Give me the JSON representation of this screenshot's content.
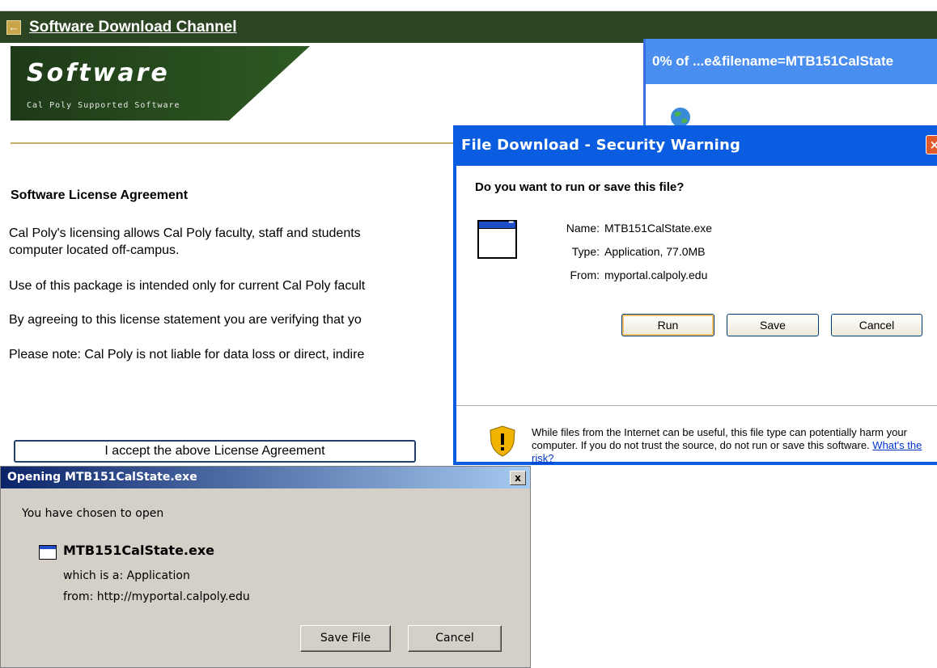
{
  "page": {
    "back_icon": "arrow-left-icon",
    "channel_title": "Software Download Channel",
    "banner": {
      "logo_word": "Software",
      "tagline": "Cal Poly Supported Software"
    },
    "heading": "Software License Agreement",
    "paragraphs": [
      "Cal Poly's licensing allows Cal Poly faculty, staff and students",
      "computer located off-campus.",
      "Use of this package is intended only for current Cal Poly facult",
      "By agreeing to this license statement you are verifying that yo",
      "Please note: Cal Poly is not liable for data loss or direct, indire"
    ],
    "accept_button": "I accept the above License Agreement"
  },
  "progress_window": {
    "title": "0% of ...e&filename=MTB151CalState",
    "icon": "globe-icon"
  },
  "security_dialog": {
    "title": "File Download - Security Warning",
    "close_label": "×",
    "question": "Do you want to run or save this file?",
    "name_label": "Name:",
    "name_value": "MTB151CalState.exe",
    "type_label": "Type:",
    "type_value": "Application, 77.0MB",
    "from_label": "From:",
    "from_value": "myportal.calpoly.edu",
    "buttons": {
      "run": "Run",
      "save": "Save",
      "cancel": "Cancel"
    },
    "warning_text": "While files from the Internet can be useful, this file type can potentially harm your computer. If you do not trust the source, do not run or save this software.",
    "risk_link": "What's the risk?"
  },
  "open_dialog": {
    "title": "Opening MTB151CalState.exe",
    "close_label": "x",
    "intro": "You have chosen to open",
    "filename": "MTB151CalState.exe",
    "which_is": "which is a:  Application",
    "from": "from:  http://myportal.calpoly.edu",
    "buttons": {
      "save_file": "Save File",
      "cancel": "Cancel"
    }
  },
  "colors": {
    "channel_bar": "#2b4422",
    "xp_blue": "#0a5de0",
    "link": "#0033cc"
  }
}
